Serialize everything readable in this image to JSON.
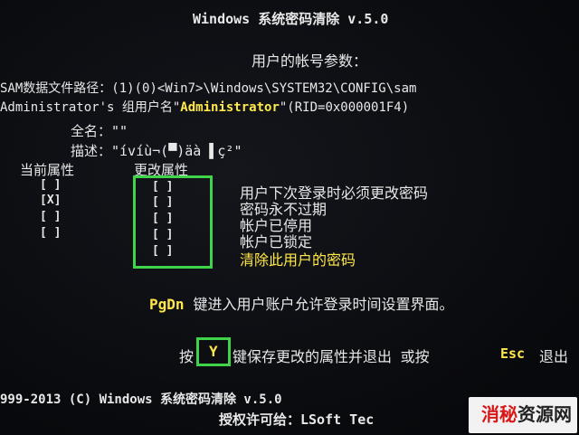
{
  "title": "Windows 系统密码清除 v.5.0",
  "subtitle": "用户的帐号参数：",
  "sam_path": "SAM数据文件路径：(1)(0)<Win7>\\Windows\\SYSTEM32\\CONFIG\\sam",
  "group_line": {
    "prefix": "Administrator's 组用户名\"",
    "username": "Administrator",
    "suffix": "\"(RID=0x000001F4)"
  },
  "fullname_line": "全名：\"\"",
  "desc_line": "描述：\"ívíù¬(▀)äà ▌ç²\"",
  "headers": {
    "current": "当前属性",
    "change": "更改属性"
  },
  "current_marks": [
    "[ ]",
    "[X]",
    "[ ]",
    "[ ]"
  ],
  "change_marks": [
    "[ ]",
    "[ ]",
    "[ ]",
    "[ ]",
    "[ ]"
  ],
  "options": [
    "用户下次登录时必须更改密码",
    "密码永不过期",
    "帐户已停用",
    "帐户已锁定",
    "清除此用户的密码"
  ],
  "pgdn": {
    "key": "PgDn",
    "text": "键进入用户账户允许登录时间设置界面。"
  },
  "save_line": {
    "prefix": "按",
    "key": "Y",
    "mid": "键保存更改的属性并退出 或按",
    "esc": "Esc",
    "tail": "退出"
  },
  "footer1": "999-2013 (C) Windows 系统密码清除 v.5.0",
  "footer2": "授权许可给：LSoft Tec",
  "watermark": {
    "red": "消秘",
    "black": "资源网"
  },
  "colors": {
    "highlight": "#ffe84a",
    "box": "#3fd44a"
  }
}
